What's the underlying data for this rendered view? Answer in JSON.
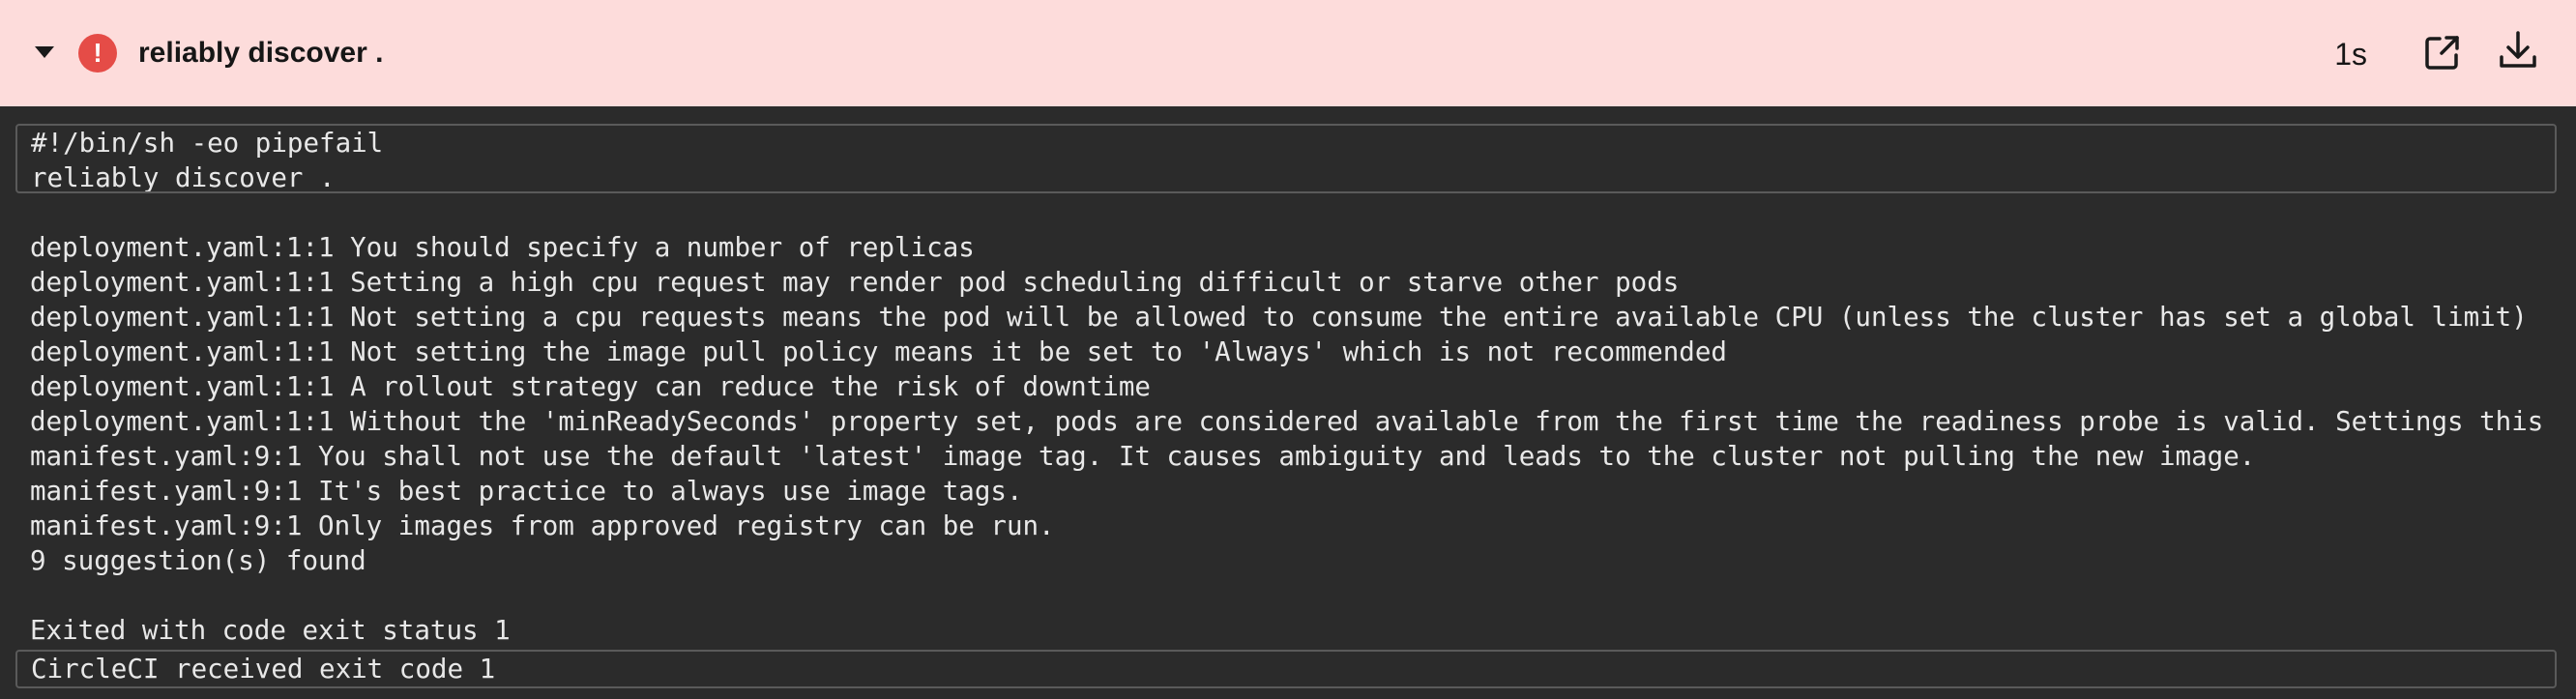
{
  "step": {
    "title": "reliably discover .",
    "duration": "1s",
    "status": "failed",
    "status_color": "#e54c47",
    "header_background": "#fddcdb",
    "icons": {
      "toggle": "caret-down-icon",
      "status": "error-icon",
      "open": "open-in-new-icon",
      "download": "download-icon"
    }
  },
  "command": {
    "lines": [
      "#!/bin/sh -eo pipefail",
      "reliably discover ."
    ]
  },
  "log": {
    "lines": [
      "deployment.yaml:1:1 You should specify a number of replicas",
      "deployment.yaml:1:1 Setting a high cpu request may render pod scheduling difficult or starve other pods",
      "deployment.yaml:1:1 Not setting a cpu requests means the pod will be allowed to consume the entire available CPU (unless the cluster has set a global limit)",
      "deployment.yaml:1:1 Not setting the image pull policy means it be set to 'Always' which is not recommended",
      "deployment.yaml:1:1 A rollout strategy can reduce the risk of downtime",
      "deployment.yaml:1:1 Without the 'minReadySeconds' property set, pods are considered available from the first time the readiness probe is valid. Settings this",
      "manifest.yaml:9:1 You shall not use the default 'latest' image tag. It causes ambiguity and leads to the cluster not pulling the new image.",
      "manifest.yaml:9:1 It's best practice to always use image tags.",
      "manifest.yaml:9:1 Only images from approved registry can be run.",
      "9 suggestion(s) found",
      "",
      "Exited with code exit status 1"
    ]
  },
  "exit_message": "CircleCI received exit code 1"
}
